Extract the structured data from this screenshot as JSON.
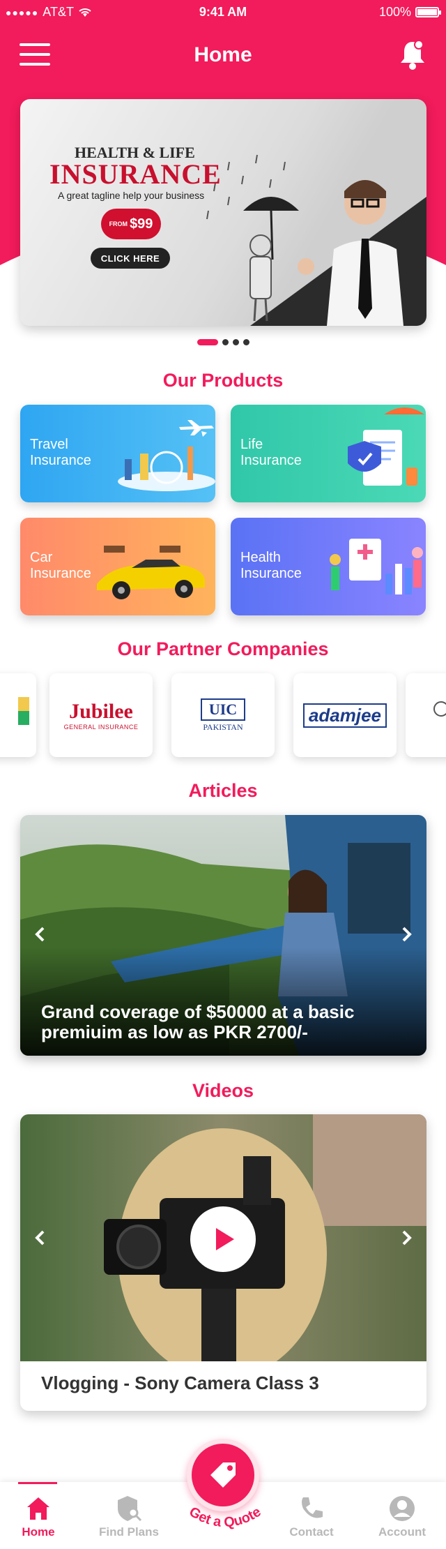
{
  "status_bar": {
    "carrier": "AT&T",
    "time": "9:41 AM",
    "battery": "100%"
  },
  "header": {
    "title": "Home"
  },
  "banner": {
    "heading_line1": "HEALTH & LIFE",
    "heading_line2": "INSURANCE",
    "tagline": "A great tagline help your business",
    "price_from": "FROM",
    "price": "$99",
    "cta": "CLICK HERE",
    "carousel": {
      "total": 4,
      "active": 1
    }
  },
  "products": {
    "title": "Our Products",
    "items": [
      {
        "label": "Travel Insurance"
      },
      {
        "label": "Life Insurance"
      },
      {
        "label": "Car Insurance"
      },
      {
        "label": "Health Insurance"
      }
    ]
  },
  "partners": {
    "title": "Our Partner Companies",
    "items": [
      {
        "name": "Jubilee",
        "subtitle": "GENERAL INSURANCE"
      },
      {
        "name": "UIC",
        "subtitle": "PAKISTAN"
      },
      {
        "name": "adamjee"
      }
    ]
  },
  "articles": {
    "title": "Articles",
    "caption": "Grand coverage of $50000 at a basic premiuim as low as PKR 2700/-"
  },
  "videos": {
    "title": "Videos",
    "video_title": "Vlogging - Sony Camera Class 3"
  },
  "tabbar": {
    "home": "Home",
    "find_plans": "Find Plans",
    "quote": "Get a Quote",
    "contact": "Contact",
    "account": "Account"
  },
  "colors": {
    "accent": "#f21b5b",
    "text_dark": "#333333",
    "inactive": "#b8b8b8"
  },
  "icons": [
    "menu-icon",
    "bell-icon",
    "plane-icon",
    "shield-icon",
    "car-icon",
    "chart-icon",
    "chevron-left-icon",
    "chevron-right-icon",
    "play-icon",
    "home-icon",
    "find-plans-icon",
    "tag-icon",
    "phone-icon",
    "account-icon"
  ]
}
